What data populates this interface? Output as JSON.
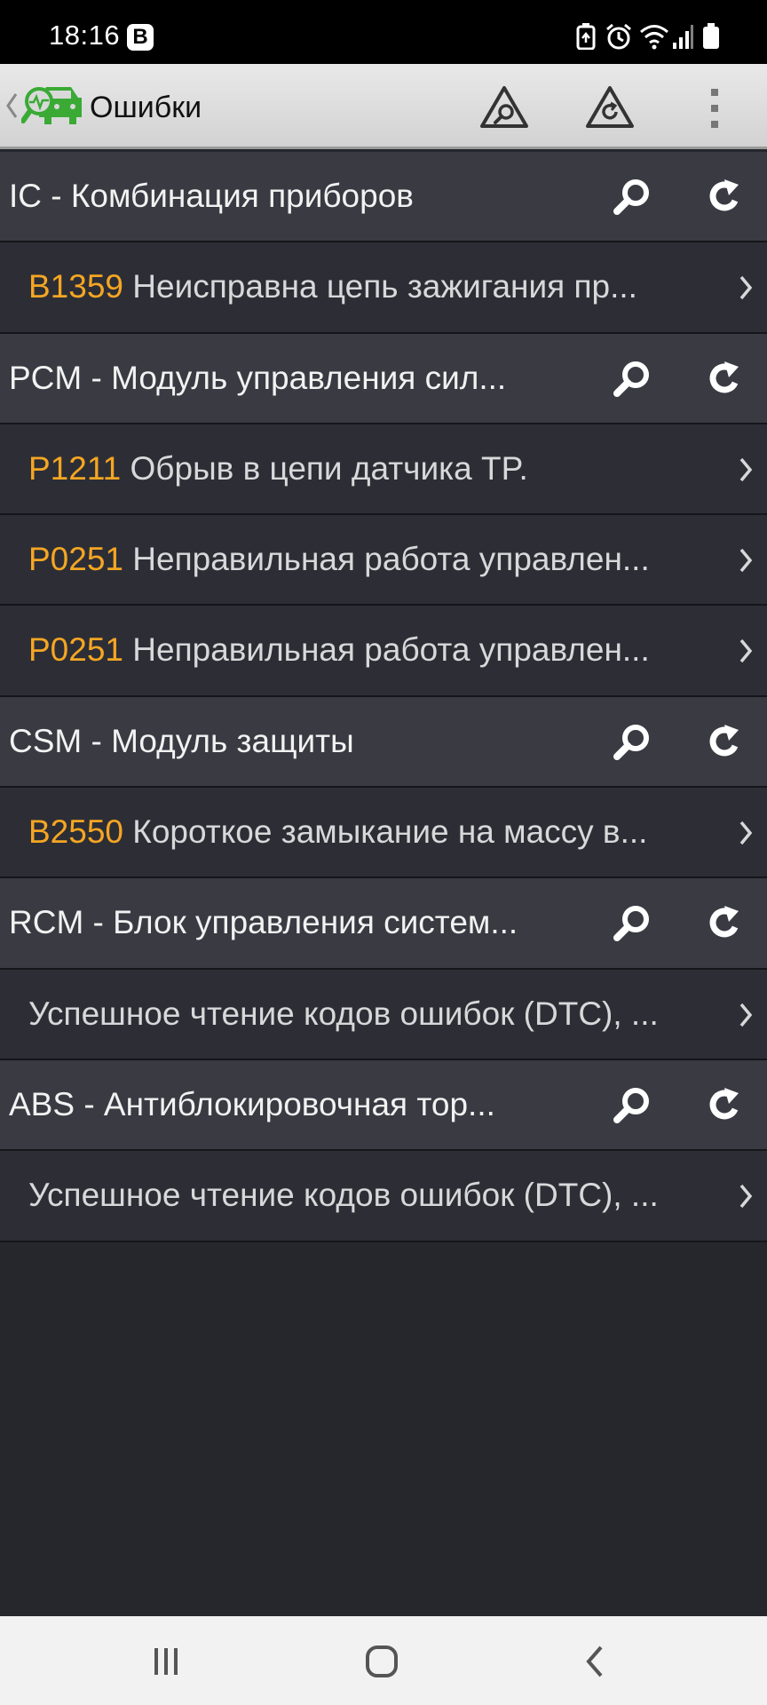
{
  "status_bar": {
    "time": "18:16",
    "badge": "B",
    "icons": [
      "battery-saver-icon",
      "alarm-icon",
      "wifi-icon",
      "signal-icon",
      "battery-icon"
    ]
  },
  "app_bar": {
    "title": "Ошибки",
    "icons": [
      "back-icon",
      "car-diagnostics-logo",
      "warning-search-icon",
      "warning-clear-icon",
      "overflow-menu-icon"
    ]
  },
  "rows": [
    {
      "type": "header",
      "label": "IC - Комбинация приборов"
    },
    {
      "type": "item",
      "code": "B1359",
      "text": "Неисправна цепь зажигания пр..."
    },
    {
      "type": "header",
      "label": "PCM - Модуль управления сил..."
    },
    {
      "type": "item",
      "code": "P1211",
      "text": "Обрыв в цепи датчика TP."
    },
    {
      "type": "item",
      "code": "P0251",
      "text": "Неправильная работа управлен..."
    },
    {
      "type": "item",
      "code": "P0251",
      "text": "Неправильная работа управлен..."
    },
    {
      "type": "header",
      "label": "CSM - Модуль защиты"
    },
    {
      "type": "item",
      "code": "B2550",
      "text": "Короткое замыкание на массу в..."
    },
    {
      "type": "header",
      "label": "RCM - Блок управления систем..."
    },
    {
      "type": "item",
      "code": "",
      "text": "Успешное чтение кодов ошибок (DTC), ..."
    },
    {
      "type": "header",
      "label": "ABS - Антиблокировочная тор..."
    },
    {
      "type": "item",
      "code": "",
      "text": "Успешное чтение кодов ошибок (DTC), ..."
    }
  ],
  "nav_bar": {
    "icons": [
      "recent-apps-icon",
      "home-icon",
      "back-nav-icon"
    ]
  },
  "colors": {
    "accent_code": "#f5a623",
    "header_bg": "#393a42",
    "item_bg": "#2d2e35",
    "logo_green": "#3aaa35"
  }
}
